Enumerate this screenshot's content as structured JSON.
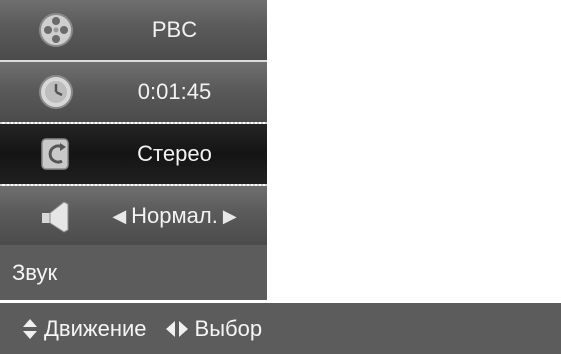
{
  "menu": {
    "items": [
      {
        "label": "PBC",
        "icon": "film-reel-icon"
      },
      {
        "label": "0:01:45",
        "icon": "clock-icon"
      },
      {
        "label": "Стерео",
        "icon": "repeat-icon"
      },
      {
        "label": "Нормал.",
        "icon": "speaker-icon"
      }
    ],
    "selected_index": 2
  },
  "section": {
    "title": "Звук"
  },
  "help": {
    "move_label": "Движение",
    "select_label": "Выбор"
  },
  "colors": {
    "panel": "#5c5c5c",
    "highlight": "#1a1a1a",
    "text": "#f2f2f2"
  }
}
